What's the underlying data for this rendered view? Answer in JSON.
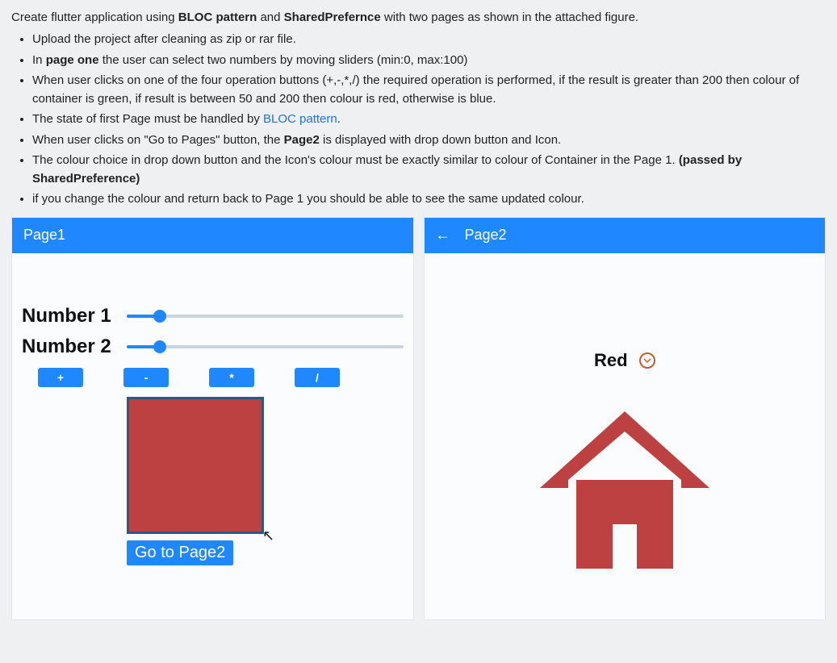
{
  "instructions": {
    "title_pre": "Create flutter application using ",
    "bold_bloc": "BLOC pattern",
    "and": " and ",
    "bold_sp": "SharedPrefernce",
    "title_post": " with two pages as shown in the attached figure.",
    "items": [
      "Upload the project after cleaning as zip or rar file.",
      "",
      "",
      "",
      "",
      "",
      ""
    ],
    "li2_pre": "In ",
    "li2_bold": "page one",
    "li2_post": " the user can select two numbers by moving sliders (min:0, max:100)",
    "li3": "When user clicks on one of the four operation buttons (+,-,*,/) the required operation is performed, if the result is greater than 200 then colour of container is green, if result is between 50 and 200 then colour is red, otherwise is blue.",
    "li4_pre": "The state of first Page must be handled by ",
    "li4_link": "BLOC pattern",
    "li4_post": ".",
    "li5_pre": "When user clicks on \"Go to Pages\" button, the ",
    "li5_bold": "Page2",
    "li5_post": " is displayed with drop down button and Icon.",
    "li6_pre": "The colour choice in drop down button and the Icon's colour must be exactly similar to colour of Container in the Page 1. ",
    "li6_bold": "(passed by SharedPreference)",
    "li7": "if you change the colour and return back to Page 1 you should be able to see the same updated colour."
  },
  "page1": {
    "title": "Page1",
    "number1_label": "Number 1",
    "number2_label": "Number 2",
    "ops": {
      "add": "+",
      "sub": "-",
      "mul": "*",
      "div": "/"
    },
    "go_label": "Go to Page2",
    "container_color": "#bd4141"
  },
  "page2": {
    "title": "Page2",
    "back_glyph": "←",
    "dropdown_value": "Red",
    "icon_color": "#bd4141"
  }
}
